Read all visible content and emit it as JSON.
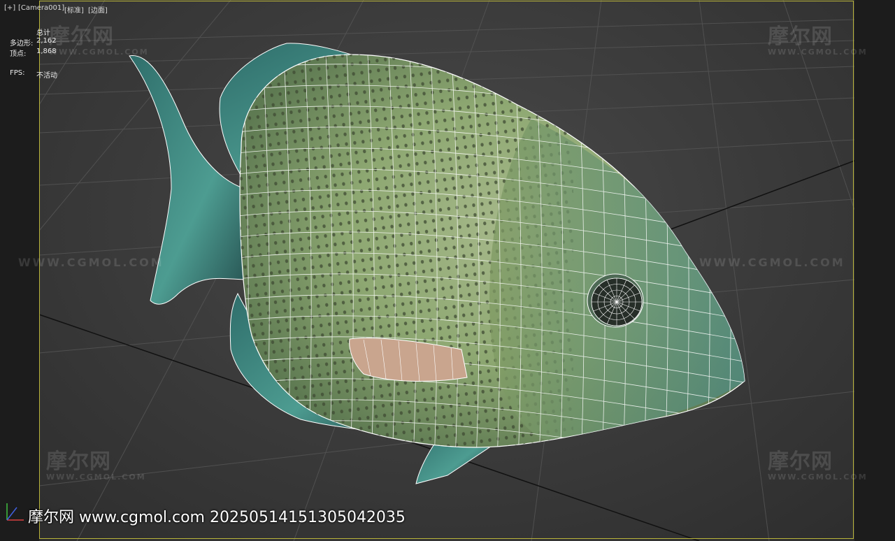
{
  "viewport": {
    "label_plus": "[+]",
    "label_camera": "[Camera001]",
    "label_shading": "[标准]",
    "label_edges": "[边面]"
  },
  "stats": {
    "total_label": "总计",
    "polys_label": "多边形:",
    "polys_value": "2,162",
    "verts_label": "顶点:",
    "verts_value": "1,868",
    "fps_label": "FPS:",
    "fps_value": "不活动"
  },
  "watermark": {
    "cn": "摩尔网",
    "en": "WWW.CGMOL.COM",
    "line": "WWW.CGMOL.COM"
  },
  "footer": {
    "text": "摩尔网 www.cgmol.com 20250514151305042035"
  },
  "colors": {
    "frame": "#b9b43a",
    "wire": "#ffffff",
    "grid": "#555555",
    "fish_body": "#8ea872",
    "fish_fin": "#3f8f86"
  },
  "icons": {
    "axis": "axis-gizmo-icon"
  }
}
